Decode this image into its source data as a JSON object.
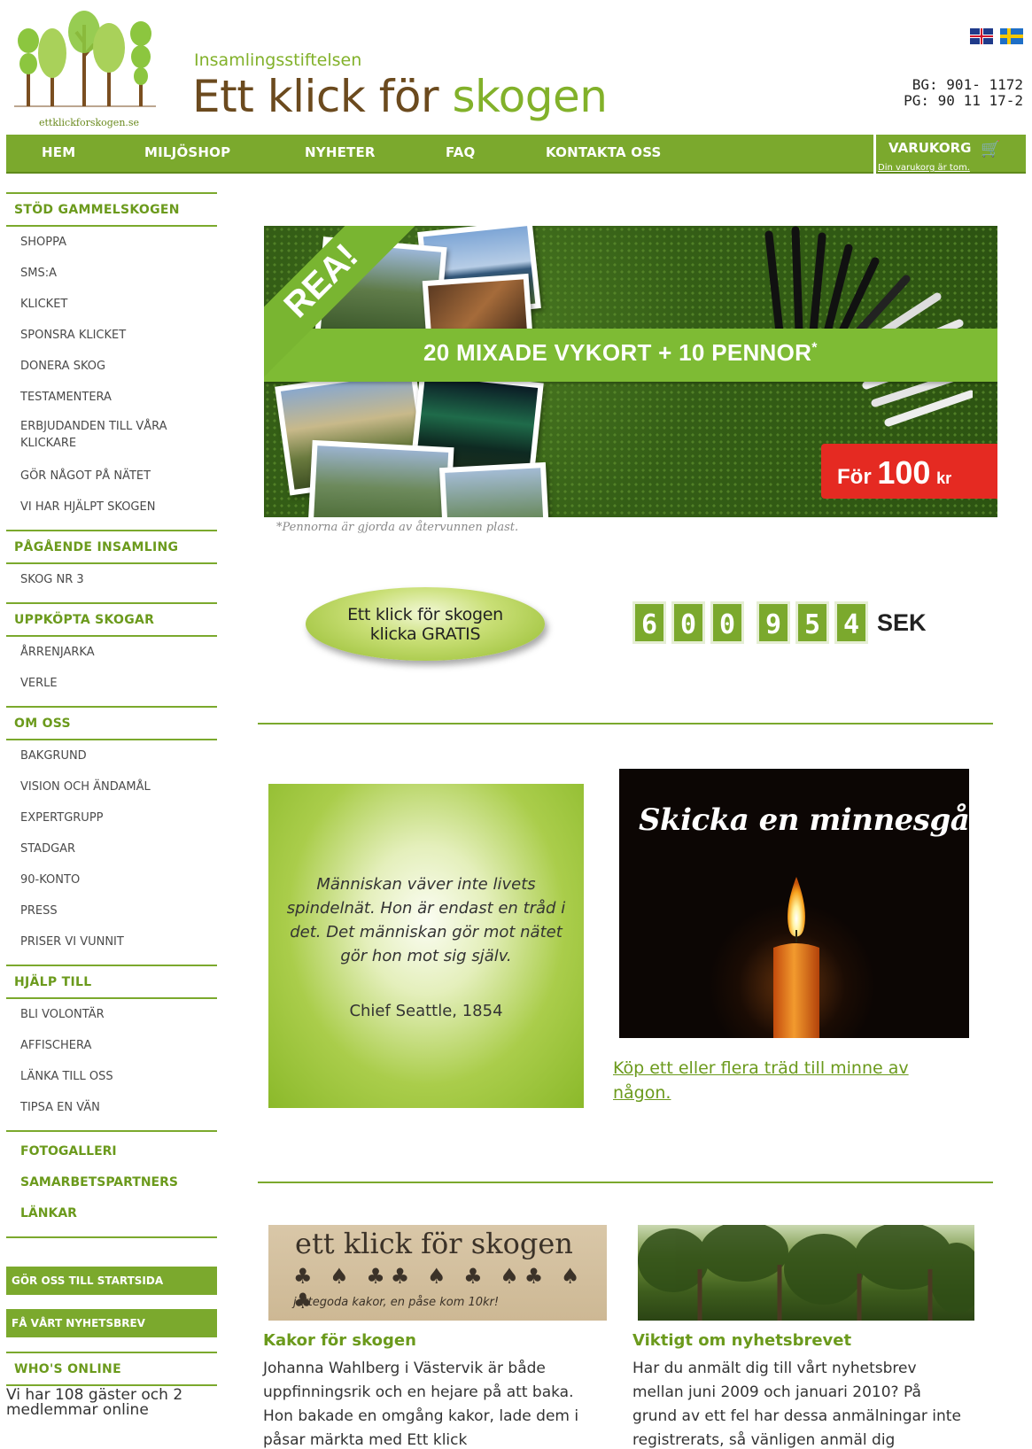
{
  "header": {
    "logo_text": "ettklickforskogen.se",
    "org_subtitle": "Insamlingsstiftelsen",
    "org_title_part1": "Ett klick för",
    "org_title_part2": "skogen",
    "bankgiro": "BG: 901- 1172",
    "plusgiro": "PG: 90 11 17-2",
    "languages": [
      "english-flag-icon",
      "swedish-flag-icon"
    ]
  },
  "nav": {
    "items": [
      "HEM",
      "MILJÖSHOP",
      "NYHETER",
      "FAQ",
      "KONTAKTA OSS"
    ],
    "cart_label": "VARUKORG",
    "cart_icon": "cart-icon",
    "cart_status": "Din varukorg är tom."
  },
  "sidebar": {
    "sections": [
      {
        "heading": "STÖD GAMMELSKOGEN",
        "items": [
          "SHOPPA",
          "SMS:A",
          "KLICKET",
          "SPONSRA KLICKET",
          "DONERA SKOG",
          "TESTAMENTERA",
          "ERBJUDANDEN TILL VÅRA KLICKARE",
          "GÖR NÅGOT PÅ NÄTET",
          "VI HAR HJÄLPT SKOGEN"
        ]
      },
      {
        "heading": "PÅGÅENDE INSAMLING",
        "items": [
          "SKOG NR 3"
        ]
      },
      {
        "heading": "UPPKÖPTA SKOGAR",
        "items": [
          "ÅRRENJARKA",
          "VERLE"
        ]
      },
      {
        "heading": "OM OSS",
        "items": [
          "BAKGRUND",
          "VISION OCH ÄNDAMÅL",
          "EXPERTGRUPP",
          "STADGAR",
          "90-KONTO",
          "PRESS",
          "PRISER VI VUNNIT"
        ]
      },
      {
        "heading": "HJÄLP TILL",
        "items": [
          "BLI VOLONTÄR",
          "AFFISCHERA",
          "LÄNKA TILL OSS",
          "TIPSA EN VÄN"
        ]
      }
    ],
    "extra_links": [
      "FOTOGALLERI",
      "SAMARBETSPARTNERS",
      "LÄNKAR"
    ],
    "buttons": [
      "GÖR OSS TILL STARTSIDA",
      "FÅ VÅRT NYHETSBREV"
    ],
    "online_heading": "WHO'S ONLINE",
    "online_text": "Vi har 108 gäster och 2 medlemmar online"
  },
  "banner": {
    "badge": "REA!",
    "offer": "20 MIXADE VYKORT + 10 PENNOR",
    "offer_mark": "*",
    "price_prefix": "För",
    "price_value": "100",
    "price_unit": "kr",
    "note": "*Pennorna är gjorda av återvunnen plast."
  },
  "click_button": {
    "line1": "Ett klick för skogen",
    "line2": "klicka GRATIS"
  },
  "counter": {
    "digits": [
      "6",
      "0",
      "0",
      "9",
      "5",
      "4"
    ],
    "unit": "SEK"
  },
  "quote": {
    "text": "Människan väver inte livets spindelnät. Hon är endast en tråd i det. Det människan gör mot nätet gör hon mot sig själv.",
    "author": "Chief Seattle, 1854"
  },
  "memorial": {
    "title": "Skicka en minnesgåva",
    "link": "Köp ett eller flera träd till minne av någon."
  },
  "news": [
    {
      "image_text_line1": "ett klick för skogen",
      "image_text_line2": "jättegoda kakor, en påse kom 10kr!",
      "title": "Kakor för skogen",
      "text": "Johanna Wahlberg i Västervik är både uppfinningsrik och en hejare på att baka. Hon bakade en omgång kakor, lade dem i påsar märkta med Ett klick"
    },
    {
      "title": "Viktigt om nyhetsbrevet",
      "text": "Har du anmält dig till vårt nyhetsbrev mellan juni 2009 och januari 2010? På grund av ett fel har dessa anmälningar inte registrerats, så vänligen anmäl dig"
    }
  ],
  "colors": {
    "brand_green": "#7ba92d",
    "brand_brown": "#6b4a1e",
    "sale_red": "#e52a22"
  }
}
